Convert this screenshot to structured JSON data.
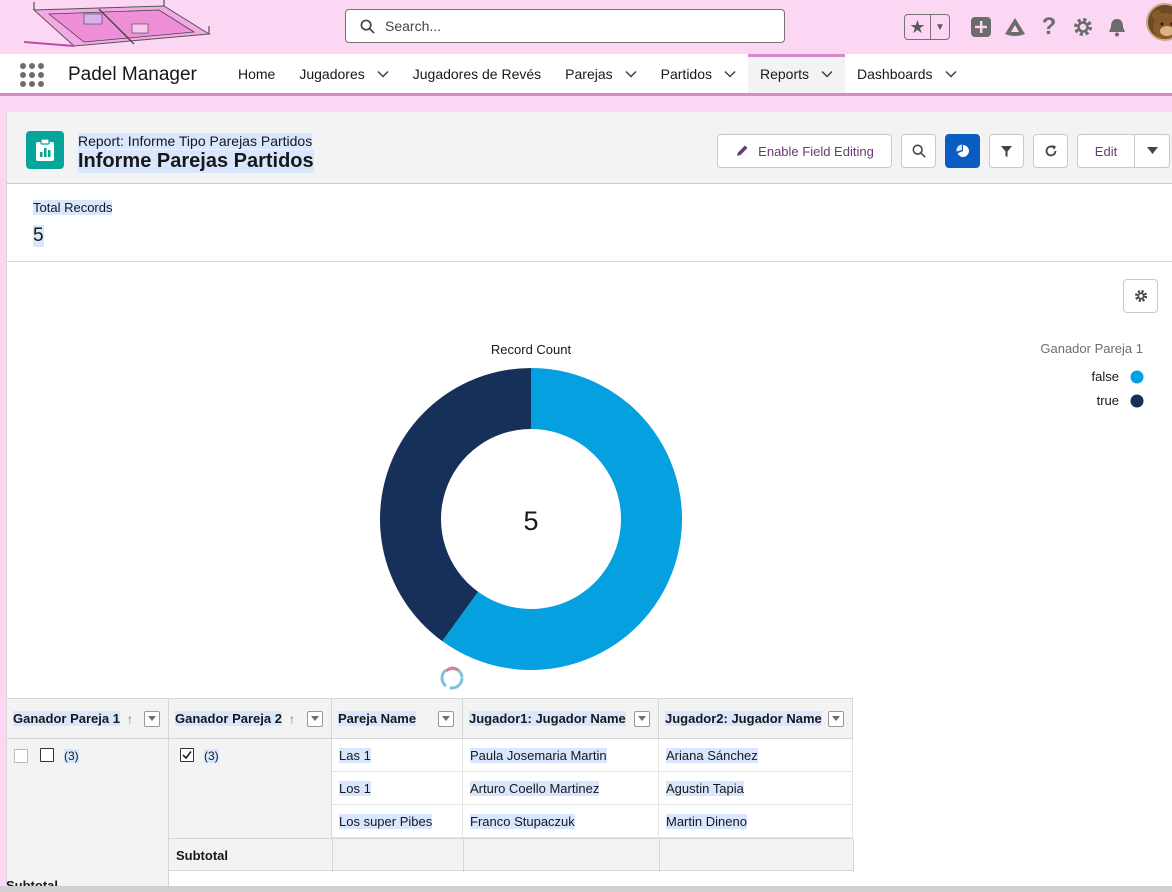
{
  "header": {
    "search_placeholder": "Search...",
    "icons": [
      "search-icon",
      "star-icon",
      "chevron-down-icon",
      "plus-icon",
      "trailhead-icon",
      "help-icon",
      "gear-icon",
      "bell-icon"
    ]
  },
  "nav": {
    "app_name": "Padel Manager",
    "items": [
      {
        "label": "Home",
        "dropdown": false
      },
      {
        "label": "Jugadores",
        "dropdown": true
      },
      {
        "label": "Jugadores de Revés",
        "dropdown": false
      },
      {
        "label": "Parejas",
        "dropdown": true
      },
      {
        "label": "Partidos",
        "dropdown": true
      },
      {
        "label": "Reports",
        "dropdown": true,
        "active": true
      },
      {
        "label": "Dashboards",
        "dropdown": true
      }
    ]
  },
  "report": {
    "subtitle": "Report: Informe Tipo Parejas Partidos",
    "title": "Informe Parejas Partidos",
    "enable_field_editing": "Enable Field Editing",
    "edit_label": "Edit",
    "accent": "#0b5cc2"
  },
  "totals": {
    "label": "Total Records",
    "value": "5"
  },
  "chart_data": {
    "type": "pie",
    "title": "Record Count",
    "center_label": "5",
    "legend_title": "Ganador Pareja 1",
    "categories": [
      "false",
      "true"
    ],
    "values": [
      3,
      2
    ],
    "colors": [
      "#04a0df",
      "#16305a"
    ],
    "legend_position": "top-right"
  },
  "table": {
    "columns": [
      {
        "label": "Ganador Pareja 1",
        "sort": "↑"
      },
      {
        "label": "Ganador Pareja 2",
        "sort": "↑"
      },
      {
        "label": "Pareja Name",
        "sort": ""
      },
      {
        "label": "Jugador1: Jugador Name",
        "sort": ""
      },
      {
        "label": "Jugador2: Jugador Name",
        "sort": ""
      }
    ],
    "group1_count": "(3)",
    "group2_count": "(3)",
    "rows": [
      {
        "pareja": "Las 1",
        "jugador1": "Paula Josemaria Martin",
        "jugador2": "Ariana Sánchez"
      },
      {
        "pareja": "Los 1",
        "jugador1": "Arturo Coello Martinez",
        "jugador2": "Agustin Tapia"
      },
      {
        "pareja": "Los super Pibes",
        "jugador1": "Franco Stupaczuk",
        "jugador2": "Martin Dineno"
      }
    ],
    "subtotal_label": "Subtotal",
    "grand_label": "Subtotal"
  }
}
